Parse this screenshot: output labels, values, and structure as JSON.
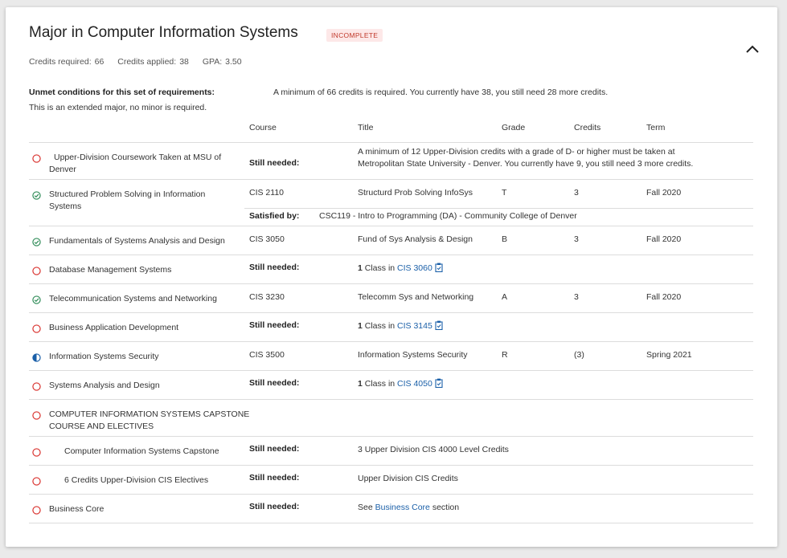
{
  "header": {
    "title": "Major in Computer Information Systems",
    "status_badge": "INCOMPLETE",
    "collapse_icon": "chevron-up-icon"
  },
  "stats": {
    "credits_required_label": "Credits required:",
    "credits_required_value": "66",
    "credits_applied_label": "Credits applied:",
    "credits_applied_value": "38",
    "gpa_label": "GPA:",
    "gpa_value": "3.50"
  },
  "unmet": {
    "label": "Unmet conditions for this set of requirements:",
    "text": "A minimum of 66 credits is required. You currently have 38, you still need 28 more credits.",
    "extended_note": "This is an extended major, no minor is required."
  },
  "columns": {
    "course": "Course",
    "title": "Title",
    "grade": "Grade",
    "credits": "Credits",
    "term": "Term"
  },
  "colors": {
    "complete": "#2e8b57",
    "incomplete": "#d9302c",
    "in_progress": "#1a5fa8",
    "link": "#1a5fa8"
  },
  "rows": [
    {
      "name": "Upper-Division Coursework Taken at MSU of Denver",
      "name_line1": "Upper-Division Coursework Taken at MSU of",
      "name_line2": "Denver",
      "status": "incomplete",
      "still_needed_label": "Still needed:",
      "detail_line1": "A minimum of 12 Upper-Division credits with a grade of D- or higher must be taken at",
      "detail_line2": "Metropolitan State University - Denver. You currently have 9, you still need 3 more credits."
    },
    {
      "name_line1": "Structured Problem Solving in Information",
      "name_line2": "Systems",
      "status": "complete",
      "course": "CIS 2110",
      "title": "Structurd Prob Solving InfoSys",
      "grade": "T",
      "credits": "3",
      "term": "Fall 2020",
      "satisfied_label": "Satisfied by:",
      "satisfied_text": "CSC119 - Intro to Programming (DA) - Community College of Denver"
    },
    {
      "name": "Fundamentals of Systems Analysis and Design",
      "status": "complete",
      "course": "CIS 3050",
      "title": "Fund of Sys Analysis & Design",
      "grade": "B",
      "credits": "3",
      "term": "Fall 2020"
    },
    {
      "name": "Database Management Systems",
      "status": "incomplete",
      "still_needed_label": "Still needed:",
      "count": "1",
      "class_in": "Class in",
      "course_link": "CIS 3060",
      "link_icon": "clipboard-icon"
    },
    {
      "name": "Telecommunication Systems and Networking",
      "status": "complete",
      "course": "CIS 3230",
      "title": "Telecomm Sys and Networking",
      "grade": "A",
      "credits": "3",
      "term": "Fall 2020"
    },
    {
      "name": "Business Application Development",
      "status": "incomplete",
      "still_needed_label": "Still needed:",
      "count": "1",
      "class_in": "Class in",
      "course_link": "CIS 3145",
      "link_icon": "clipboard-icon"
    },
    {
      "name": "Information Systems Security",
      "status": "in-progress",
      "course": "CIS 3500",
      "title": "Information Systems Security",
      "grade": "R",
      "credits": "(3)",
      "term": "Spring 2021"
    },
    {
      "name": "Systems Analysis and Design",
      "status": "incomplete",
      "still_needed_label": "Still needed:",
      "count": "1",
      "class_in": "Class in",
      "course_link": "CIS 4050",
      "link_icon": "clipboard-icon"
    },
    {
      "name_line1": "COMPUTER INFORMATION SYSTEMS CAPSTONE",
      "name_line2": "COURSE AND ELECTIVES",
      "status": "incomplete"
    },
    {
      "name": "Computer Information Systems Capstone",
      "status": "incomplete",
      "still_needed_label": "Still needed:",
      "detail": "3 Upper Division CIS 4000 Level Credits"
    },
    {
      "name": "6 Credits Upper-Division CIS Electives",
      "status": "incomplete",
      "still_needed_label": "Still needed:",
      "detail": "Upper Division CIS Credits"
    },
    {
      "name": "Business Core",
      "status": "incomplete",
      "still_needed_label": "Still needed:",
      "see": "See",
      "section_link": "Business Core",
      "section_word": "section"
    }
  ]
}
